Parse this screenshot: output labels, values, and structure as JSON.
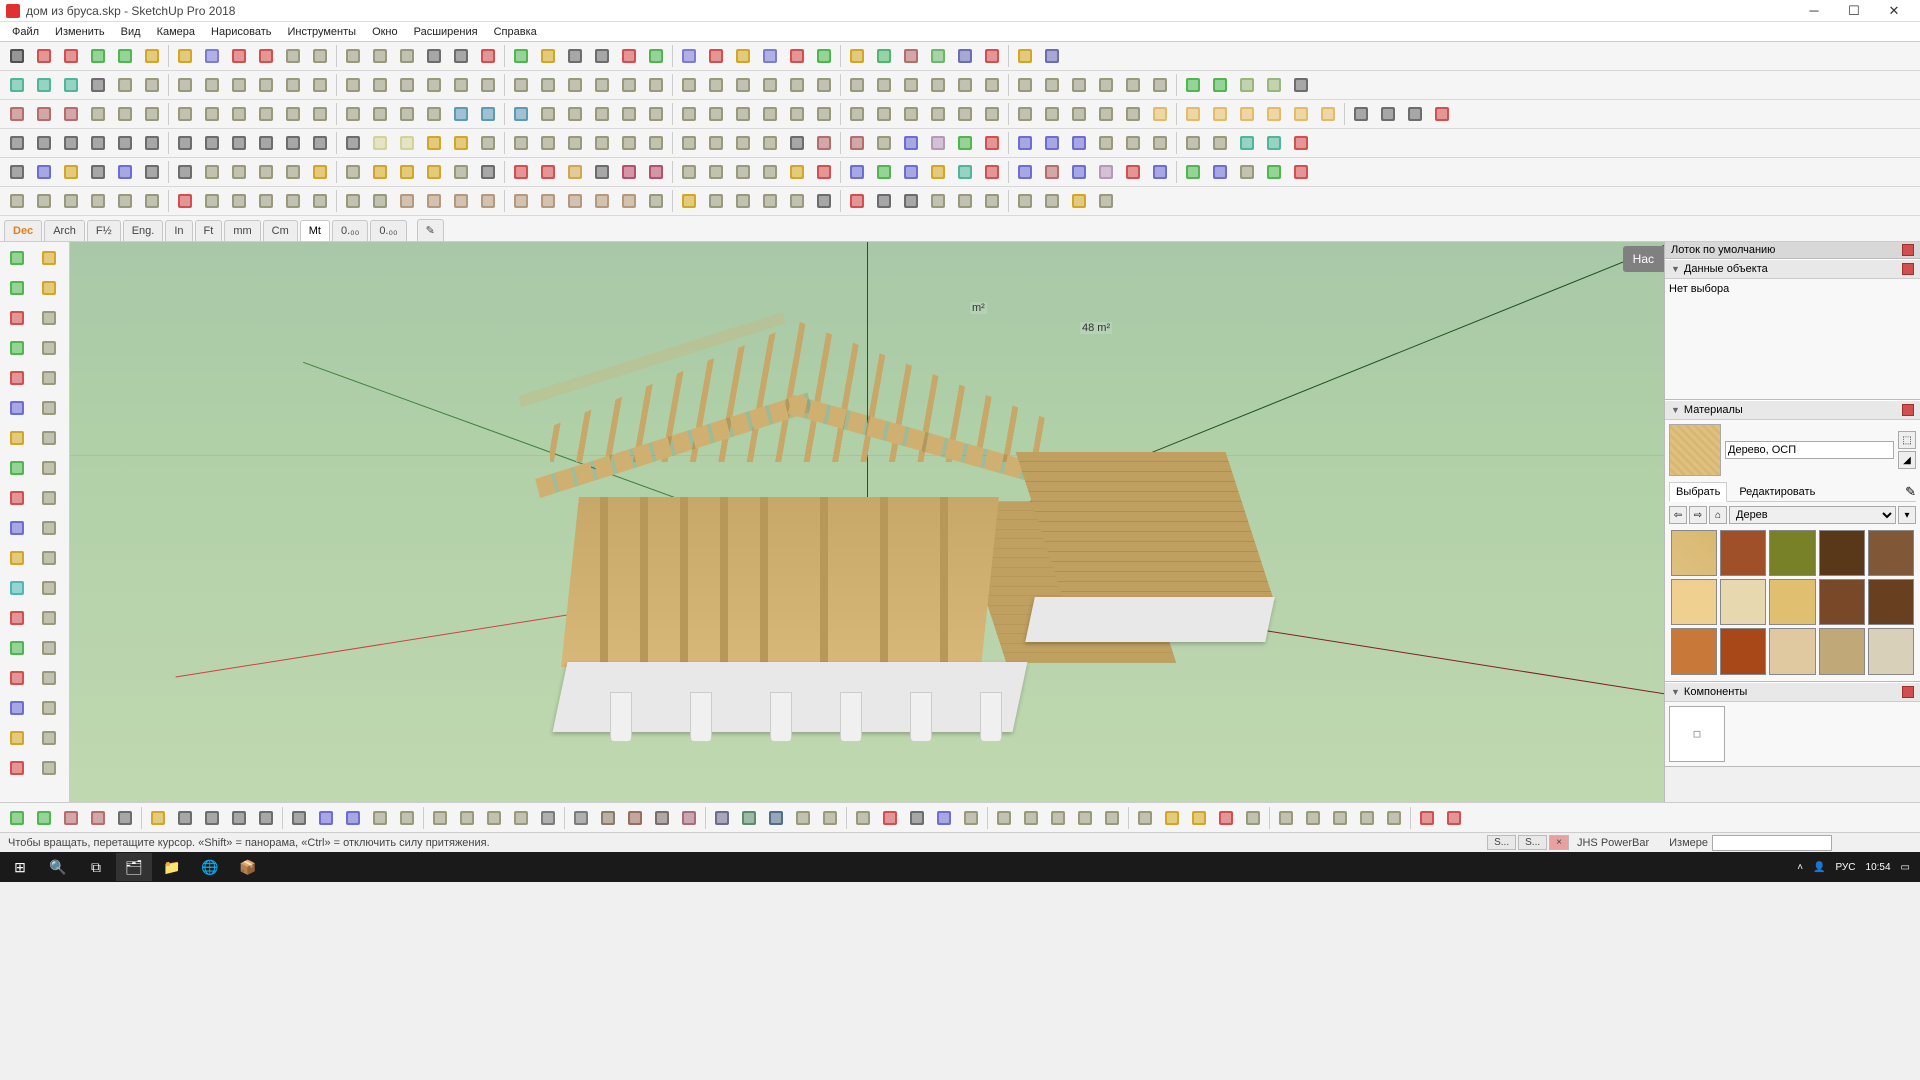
{
  "title": "дом из бруса.skp - SketchUp Pro 2018",
  "menu": [
    "Файл",
    "Изменить",
    "Вид",
    "Камера",
    "Нарисовать",
    "Инструменты",
    "Окно",
    "Расширения",
    "Справка"
  ],
  "unit_tabs": [
    "Dec",
    "Arch",
    "F½",
    "Eng.",
    "In",
    "Ft",
    "mm",
    "Cm",
    "Mt",
    "0.₀₀",
    "0.₀₀"
  ],
  "unit_active": "Mt",
  "tray": {
    "title": "Лоток по умолчанию",
    "entity": {
      "title": "Данные объекта",
      "empty": "Нет выбора"
    },
    "materials": {
      "title": "Материалы",
      "name": "Дерево, ОСП",
      "tab_select": "Выбрать",
      "tab_edit": "Редактировать",
      "category": "Дерев",
      "swatch_colors": [
        "linear-gradient(45deg,#e0c080,#d8b870)",
        "#a05028",
        "#788028",
        "#583818",
        "#805838",
        "#f0d090",
        "#e8d8b0",
        "#e0c070",
        "#784828",
        "#684020",
        "#c87838",
        "#a84818",
        "#e0c8a0",
        "#c0a878",
        "#d8d0b8"
      ]
    },
    "components": {
      "title": "Компоненты"
    }
  },
  "viewport": {
    "tray_btn": "Нас",
    "dim1": "m²",
    "dim2": "48 m²"
  },
  "status": {
    "hint": "Чтобы вращать, перетащите курсор. «Shift» = панорама, «Ctrl» = отключить силу притяжения.",
    "measure_label": "Измере",
    "tabs": [
      "S...",
      "S...",
      "×"
    ],
    "powerbar": "JHS PowerBar"
  },
  "taskbar": {
    "lang": "РУС",
    "time": "10:54"
  },
  "toolbar_row_counts": [
    38,
    47,
    52,
    47,
    47,
    40
  ],
  "toolbar_colors": [
    [
      "#333",
      "#c33",
      "#c33",
      "#3a3",
      "#3a3",
      "#c90",
      "#c90",
      "#66c",
      "#c33",
      "#c33",
      "#886",
      "#886",
      "#886",
      "#886",
      "#886",
      "#555",
      "#555",
      "#c33",
      "#3a3",
      "#c90",
      "#555",
      "#555",
      "#c33",
      "#3a3",
      "#66c",
      "#c33",
      "#c90",
      "#66c",
      "#c33",
      "#3a3",
      "#c90",
      "#3a5",
      "#a55",
      "#5a5",
      "#55a",
      "#c33",
      "#c90",
      "#55a"
    ],
    [
      "#3a8",
      "#3a8",
      "#3a8",
      "#555",
      "#886",
      "#886",
      "#886",
      "#886",
      "#886",
      "#886",
      "#886",
      "#886",
      "#886",
      "#886",
      "#886",
      "#886",
      "#886",
      "#886",
      "#886",
      "#886",
      "#886",
      "#886",
      "#886",
      "#886",
      "#886",
      "#886",
      "#886",
      "#886",
      "#886",
      "#886",
      "#886",
      "#886",
      "#886",
      "#886",
      "#886",
      "#886",
      "#886",
      "#886",
      "#886",
      "#886",
      "#886",
      "#886",
      "#3a3",
      "#3a3",
      "#8a6",
      "#8a6",
      "#555"
    ],
    [
      "#a55",
      "#a55",
      "#a55",
      "#886",
      "#886",
      "#886",
      "#886",
      "#886",
      "#886",
      "#886",
      "#886",
      "#886",
      "#886",
      "#886",
      "#886",
      "#886",
      "#48a",
      "#48a",
      "#48a",
      "#886",
      "#886",
      "#886",
      "#886",
      "#886",
      "#886",
      "#886",
      "#886",
      "#886",
      "#886",
      "#886",
      "#886",
      "#886",
      "#886",
      "#886",
      "#886",
      "#886",
      "#886",
      "#886",
      "#886",
      "#886",
      "#886",
      "#e0b050",
      "#e0b050",
      "#e0b050",
      "#e0b050",
      "#e0b050",
      "#e0b050",
      "#e0b050",
      "#555",
      "#555",
      "#555",
      "#c33"
    ],
    [
      "#555",
      "#555",
      "#555",
      "#555",
      "#555",
      "#555",
      "#555",
      "#555",
      "#555",
      "#555",
      "#555",
      "#555",
      "#555",
      "#cc8",
      "#cc8",
      "#c90",
      "#c90",
      "#886",
      "#886",
      "#886",
      "#886",
      "#886",
      "#886",
      "#886",
      "#886",
      "#886",
      "#886",
      "#886",
      "#555",
      "#a55",
      "#a55",
      "#886",
      "#55c",
      "#a8a",
      "#3a3",
      "#c33",
      "#55c",
      "#55c",
      "#55c",
      "#886",
      "#886",
      "#886",
      "#886",
      "#886",
      "#3a8",
      "#3a8",
      "#c33"
    ],
    [
      "#555",
      "#55c",
      "#c90",
      "#555",
      "#55c",
      "#555",
      "#555",
      "#886",
      "#886",
      "#886",
      "#886",
      "#c90",
      "#886",
      "#c90",
      "#c90",
      "#c90",
      "#886",
      "#555",
      "#c33",
      "#c33",
      "#c93",
      "#555",
      "#a35",
      "#a35",
      "#886",
      "#886",
      "#886",
      "#886",
      "#c90",
      "#c33",
      "#55c",
      "#3a3",
      "#55c",
      "#c90",
      "#3a8",
      "#c33",
      "#55c",
      "#a55",
      "#55c",
      "#a8a",
      "#c33",
      "#55c",
      "#3a3",
      "#55c",
      "#886",
      "#3a3",
      "#c33"
    ],
    [
      "#886",
      "#886",
      "#886",
      "#886",
      "#886",
      "#886",
      "#c33",
      "#886",
      "#886",
      "#886",
      "#886",
      "#886",
      "#886",
      "#886",
      "#a86",
      "#a86",
      "#a86",
      "#a86",
      "#a86",
      "#a86",
      "#a86",
      "#a86",
      "#a86",
      "#886",
      "#c90",
      "#886",
      "#886",
      "#886",
      "#886",
      "#555",
      "#c33",
      "#555",
      "#555",
      "#886",
      "#886",
      "#886",
      "#886",
      "#886",
      "#c90",
      "#886"
    ]
  ],
  "left_tool_colors": [
    "#3a3",
    "#c90",
    "#3a3",
    "#c90",
    "#c33",
    "#886",
    "#3a3",
    "#886",
    "#c33",
    "#886",
    "#55c",
    "#886",
    "#c90",
    "#886",
    "#3a3",
    "#886",
    "#c33",
    "#886",
    "#55c",
    "#886",
    "#c90",
    "#886",
    "#3aa",
    "#886",
    "#c33",
    "#886",
    "#3a3",
    "#886",
    "#c33",
    "#886",
    "#55c",
    "#886",
    "#c90",
    "#886",
    "#c33",
    "#886"
  ],
  "bottom_tool_colors": [
    "#3a3",
    "#3a3",
    "#a55",
    "#a55",
    "#555",
    "#c90",
    "#555",
    "#555",
    "#555",
    "#555",
    "#555",
    "#55c",
    "#55c",
    "#886",
    "#886",
    "#886",
    "#886",
    "#886",
    "#886",
    "#666",
    "#666",
    "#765",
    "#854",
    "#655",
    "#956",
    "#557",
    "#475",
    "#357",
    "#886",
    "#886",
    "#886",
    "#c33",
    "#555",
    "#55c",
    "#886",
    "#886",
    "#886",
    "#886",
    "#886",
    "#886",
    "#886",
    "#c90",
    "#c90",
    "#c33",
    "#886",
    "#886",
    "#886",
    "#886",
    "#886",
    "#886",
    "#c33",
    "#c33"
  ]
}
